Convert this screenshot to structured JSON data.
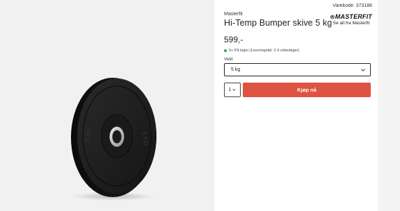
{
  "product": {
    "sku_label": "Varekode: 373186",
    "brand": "Masterfit",
    "title": "Hi-Temp Bumper skive 5 kg",
    "price": "599,-",
    "stock_status": "5+ På lager (Leveringstid: 2-4 virkedager)",
    "stock_color": "#3fa34d"
  },
  "brand_logo": {
    "text": "MASTERFIT",
    "subtitle": "Se alt fra Masterfit"
  },
  "variant": {
    "label": "Vekt",
    "selected": "5 kg"
  },
  "purchase": {
    "quantity": "1",
    "buy_label": "Kjøp nå",
    "buy_color": "#de5341"
  },
  "image": {
    "plate_text_left": "5 KG",
    "plate_text_right": "5 KG"
  }
}
